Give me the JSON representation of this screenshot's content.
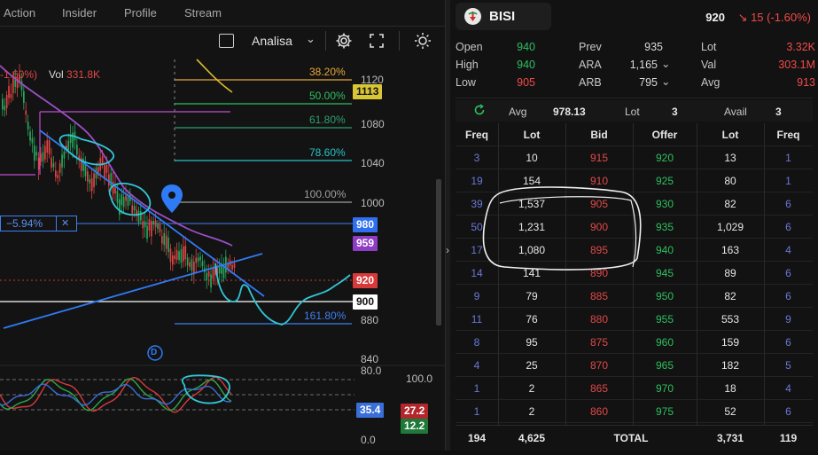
{
  "tabs": [
    "Action",
    "Insider",
    "Profile",
    "Stream"
  ],
  "toolbar": {
    "mode_label": "Analisa"
  },
  "chart": {
    "change_badge": "-1.60%)",
    "vol_label": "Vol",
    "vol_value": "331.8K",
    "measure_label": "−5.94%",
    "measure_close": "✕",
    "marker_letter": "D",
    "price_axis": [
      "1120",
      "1080",
      "1040",
      "1000",
      "880",
      "840"
    ],
    "price_chips": {
      "p1113": "1113",
      "p980": "980",
      "p959": "959",
      "p920": "920",
      "p900": "900"
    },
    "fib_levels": [
      "38.20%",
      "50.00%",
      "61.80%",
      "78.60%",
      "100.00%",
      "161.80%"
    ],
    "indicator_axis": [
      "80.0",
      "100.0",
      "35.4",
      "0.0"
    ],
    "indicator_chips": {
      "blue": "35.4",
      "red": "27.2",
      "green": "12.2"
    },
    "colors": {
      "up": "#26a65b",
      "down": "#e04343",
      "fib_orange": "#e8a53a",
      "fib_green": "#2fbf5f",
      "fib_cyan": "#27c2c9",
      "fib_grey": "#9e9e9e",
      "fib_blue": "#3f7ff0",
      "trend_blue": "#2f7bf5",
      "ma_purple": "#9b4fc7",
      "annot_cyan": "#31c6d6"
    }
  },
  "quote": {
    "code": "BISI",
    "last": "920",
    "change": "↘ 15 (-1.60%)",
    "stats": [
      {
        "label": "Open",
        "value": "940",
        "color": "#2fbf5f"
      },
      {
        "label": "High",
        "value": "940",
        "color": "#2fbf5f"
      },
      {
        "label": "Low",
        "value": "905",
        "color": "#f24a4a"
      },
      {
        "label": "Prev",
        "value": "935",
        "color": "#d8d8d8"
      },
      {
        "label": "ARA",
        "value": "1,165",
        "color": "#d8d8d8"
      },
      {
        "label": "ARB",
        "value": "795",
        "color": "#d8d8d8"
      },
      {
        "label": "Lot",
        "value": "3.32K",
        "color": "#f24a4a"
      },
      {
        "label": "Val",
        "value": "303.1M",
        "color": "#f24a4a"
      },
      {
        "label": "Avg",
        "value": "913",
        "color": "#f24a4a"
      }
    ]
  },
  "orderbook": {
    "avg_label": "Avg",
    "avg_value": "978.13",
    "lot_label": "Lot",
    "lot_value": "3",
    "avail_label": "Avail",
    "avail_value": "3",
    "headers": [
      "Freq",
      "Lot",
      "Bid",
      "Offer",
      "Lot",
      "Freq"
    ],
    "rows": [
      {
        "bf": "3",
        "bl": "10",
        "bid": "915",
        "offer": "920",
        "ol": "13",
        "of": "1"
      },
      {
        "bf": "19",
        "bl": "154",
        "bid": "910",
        "offer": "925",
        "ol": "80",
        "of": "1"
      },
      {
        "bf": "39",
        "bl": "1,537",
        "bid": "905",
        "offer": "930",
        "ol": "82",
        "of": "6"
      },
      {
        "bf": "50",
        "bl": "1,231",
        "bid": "900",
        "offer": "935",
        "ol": "1,029",
        "of": "6"
      },
      {
        "bf": "17",
        "bl": "1,080",
        "bid": "895",
        "offer": "940",
        "ol": "163",
        "of": "4"
      },
      {
        "bf": "14",
        "bl": "141",
        "bid": "890",
        "offer": "945",
        "ol": "89",
        "of": "6"
      },
      {
        "bf": "9",
        "bl": "79",
        "bid": "885",
        "offer": "950",
        "ol": "82",
        "of": "6"
      },
      {
        "bf": "11",
        "bl": "76",
        "bid": "880",
        "offer": "955",
        "ol": "553",
        "of": "9"
      },
      {
        "bf": "8",
        "bl": "95",
        "bid": "875",
        "offer": "960",
        "ol": "159",
        "of": "6"
      },
      {
        "bf": "4",
        "bl": "25",
        "bid": "870",
        "offer": "965",
        "ol": "182",
        "of": "5"
      },
      {
        "bf": "1",
        "bl": "2",
        "bid": "865",
        "offer": "970",
        "ol": "18",
        "of": "4"
      },
      {
        "bf": "1",
        "bl": "2",
        "bid": "860",
        "offer": "975",
        "ol": "52",
        "of": "6"
      }
    ],
    "total": {
      "bf": "194",
      "bl": "4,625",
      "label": "TOTAL",
      "ol": "3,731",
      "of": "119"
    },
    "colors": {
      "freq": "#6b78d8",
      "bid": "#e04848",
      "offer": "#2fbf5f"
    }
  }
}
